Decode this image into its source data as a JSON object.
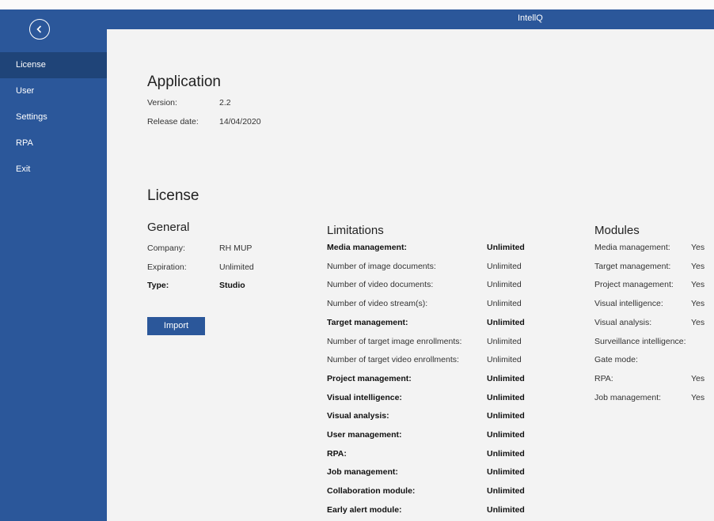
{
  "app": {
    "title": "IntellQ"
  },
  "sidebar": {
    "back_icon": "chevron-left-icon",
    "items": [
      {
        "label": "License",
        "active": true
      },
      {
        "label": "User"
      },
      {
        "label": "Settings"
      },
      {
        "label": "RPA"
      },
      {
        "label": "Exit"
      }
    ]
  },
  "application": {
    "heading": "Application",
    "version_label": "Version:",
    "version_value": "2.2",
    "release_label": "Release date:",
    "release_value": "14/04/2020"
  },
  "license": {
    "heading": "License",
    "general": {
      "heading": "General",
      "company_label": "Company:",
      "company_value": "RH MUP",
      "expiration_label": "Expiration:",
      "expiration_value": "Unlimited",
      "type_label": "Type:",
      "type_value": "Studio",
      "import_button": "Import"
    },
    "limitations": {
      "heading": "Limitations",
      "rows": [
        {
          "label": "Media management:",
          "value": "Unlimited",
          "bold": true
        },
        {
          "label": "Number of image documents:",
          "value": "Unlimited"
        },
        {
          "label": "Number of video documents:",
          "value": "Unlimited"
        },
        {
          "label": "Number of video stream(s):",
          "value": "Unlimited"
        },
        {
          "label": "Target management:",
          "value": "Unlimited",
          "bold": true
        },
        {
          "label": "Number of target image enrollments:",
          "value": "Unlimited"
        },
        {
          "label": "Number of target video enrollments:",
          "value": "Unlimited"
        },
        {
          "label": "Project management:",
          "value": "Unlimited",
          "bold": true
        },
        {
          "label": "Visual intelligence:",
          "value": "Unlimited",
          "bold": true
        },
        {
          "label": "Visual analysis:",
          "value": "Unlimited",
          "bold": true
        },
        {
          "label": "User management:",
          "value": "Unlimited",
          "bold": true
        },
        {
          "label": "RPA:",
          "value": "Unlimited",
          "bold": true
        },
        {
          "label": "Job management:",
          "value": "Unlimited",
          "bold": true
        },
        {
          "label": "Collaboration module:",
          "value": "Unlimited",
          "bold": true
        },
        {
          "label": "Early alert module:",
          "value": "Unlimited",
          "bold": true
        }
      ]
    },
    "modules": {
      "heading": "Modules",
      "rows": [
        {
          "label": "Media management:",
          "value": "Yes"
        },
        {
          "label": "Target management:",
          "value": "Yes"
        },
        {
          "label": "Project management:",
          "value": "Yes"
        },
        {
          "label": "Visual intelligence:",
          "value": "Yes"
        },
        {
          "label": "Visual analysis:",
          "value": "Yes"
        },
        {
          "label": "Surveillance intelligence:",
          "value": ""
        },
        {
          "label": "Gate mode:",
          "value": ""
        },
        {
          "label": "RPA:",
          "value": "Yes"
        },
        {
          "label": "Job management:",
          "value": "Yes"
        }
      ]
    }
  },
  "colors": {
    "accent": "#2b579a",
    "sidebar_active": "#1f4478",
    "background": "#f3f3f3"
  }
}
